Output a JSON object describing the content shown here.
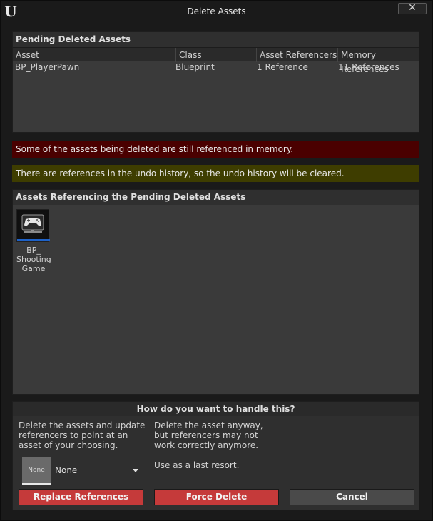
{
  "window": {
    "title": "Delete Assets",
    "close_glyph": "✕"
  },
  "pending": {
    "header": "Pending Deleted Assets",
    "columns": [
      "Asset",
      "Class",
      "Asset Referencers",
      "Memory References"
    ],
    "rows": [
      {
        "asset": "BP_PlayerPawn",
        "class": "Blueprint",
        "referencers": "1 Reference",
        "memory": "11 References"
      }
    ]
  },
  "messages": {
    "error": "Some of the assets being deleted are still referenced in memory.",
    "warning": "There are references in the undo history, so the undo history will be cleared."
  },
  "referencing": {
    "header": "Assets Referencing the Pending Deleted Assets",
    "tiles": [
      {
        "label_line1": "BP_",
        "label_line2": "Shooting",
        "label_line3": "Game",
        "icon": "gamepad-icon"
      }
    ]
  },
  "options": {
    "header": "How do you want to handle this?",
    "replace_desc": "Delete the assets and update referencers to point at an asset of your choosing.",
    "force_desc": "Delete the asset anyway, but referencers may not work correctly anymore.",
    "force_note": "Use as a last resort.",
    "none_thumb_label": "None",
    "combo_value": "None",
    "replace_button": "Replace References",
    "force_button": "Force Delete",
    "cancel_button": "Cancel"
  },
  "colors": {
    "error_bg": "#4a0000",
    "warning_bg": "#3e3d00",
    "danger_button": "#c53a3a",
    "selection_accent": "#1e62c8"
  }
}
